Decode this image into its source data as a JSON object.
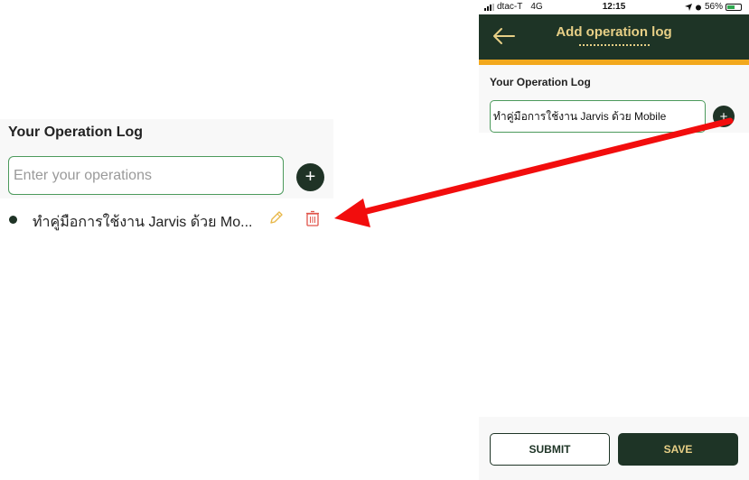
{
  "left_panel": {
    "title": "Your Operation Log",
    "input_placeholder": "Enter your operations",
    "add_button_symbol": "+",
    "log_items": [
      {
        "text": "ทำคู่มือการใช้งาน Jarvis ด้วย Mo..."
      }
    ],
    "edit_icon": "pencil-icon",
    "delete_icon": "trash-icon"
  },
  "status_bar": {
    "carrier": "dtac-T",
    "network": "4G",
    "time": "12:15",
    "battery": "56%",
    "battery_level": 0.56
  },
  "header": {
    "title": "Add operation log",
    "back_icon": "back-arrow-icon"
  },
  "form": {
    "title": "Your Operation Log",
    "input_value": "ทำคู่มือการใช้งาน Jarvis ด้วย Mobile",
    "add_button_symbol": "+"
  },
  "actions": {
    "submit_label": "SUBMIT",
    "save_label": "SAVE"
  },
  "colors": {
    "brand_dark": "#1e3426",
    "accent_gold": "#e7cf86",
    "accent_orange": "#f2a81d",
    "input_border": "#4c9a5c",
    "annotation_arrow": "#f20d0d"
  }
}
